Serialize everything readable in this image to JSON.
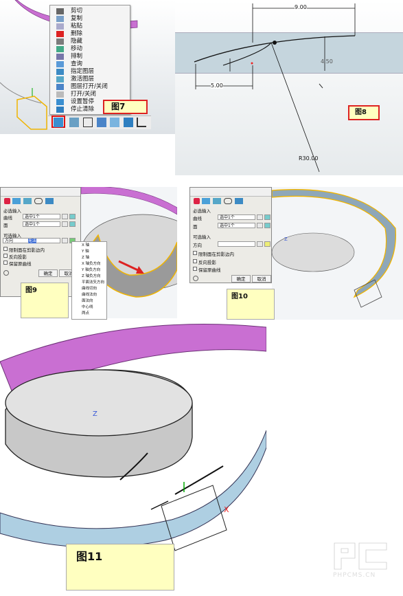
{
  "fig7": {
    "caption": "图7",
    "menu_items": [
      {
        "label": "剪切",
        "icon": "scissors-icon"
      },
      {
        "label": "复制",
        "icon": "copy-icon"
      },
      {
        "label": "粘贴",
        "icon": "paste-icon"
      },
      {
        "label": "删除",
        "icon": "delete-icon"
      },
      {
        "label": "隐藏",
        "icon": "hide-icon"
      },
      {
        "label": "移动",
        "icon": "move-icon"
      },
      {
        "label": "排制",
        "icon": "array-icon"
      },
      {
        "label": "查询",
        "icon": "query-icon"
      },
      {
        "label": "指定图层",
        "icon": "layer-icon"
      },
      {
        "label": "激活图层",
        "icon": "activate-layer-icon"
      },
      {
        "label": "图层打开/关闭",
        "icon": "layer-toggle-icon"
      },
      {
        "label": "打开/关闭",
        "icon": "toggle-icon"
      },
      {
        "label": "设置暂停",
        "icon": "pause-icon"
      },
      {
        "label": "停止清除",
        "icon": "stop-icon"
      }
    ]
  },
  "fig8": {
    "caption": "图8",
    "dim_top": "9.00",
    "dim_right": "4.50",
    "dim_left": "5.00",
    "dim_radius": "R30.00"
  },
  "fig9": {
    "caption": "图9",
    "section_required": "必选输入",
    "label_curve": "曲线",
    "value_curve": "选中1个",
    "label_face": "面",
    "value_face": "选中1个",
    "section_optional": "可选输入",
    "label_direction": "方向",
    "direction_value": "无法",
    "opt_limit": "限制面在剪影边内",
    "opt_reverse": "反向投影",
    "opt_keep": "保留原曲线",
    "ok": "确定",
    "cancel": "取消",
    "dropdown": [
      "X 轴",
      "Y 轴",
      "Z 轴",
      "X 轴负方向",
      "Y 轴负方向",
      "Z 轴负方向",
      "平面法矢方向",
      "曲线切向",
      "曲线法向",
      "面法向",
      "中心线",
      "两点"
    ]
  },
  "fig10": {
    "caption": "图10",
    "section_required": "必选输入",
    "label_curve": "曲线",
    "value_curve": "选中1个",
    "label_face": "面",
    "value_face": "选中1个",
    "section_optional": "可选输入",
    "label_direction": "方向",
    "opt_limit": "限制面在剪影边内",
    "opt_reverse": "反向投影",
    "opt_keep": "保留原曲线",
    "ok": "确定",
    "cancel": "取消",
    "axis_z": "Z"
  },
  "fig11": {
    "caption": "图11",
    "axis_z": "Z",
    "axis_x": "X"
  },
  "watermark": "PHPCMS.CN",
  "colors": {
    "ring_purple": "#c96fd2",
    "ring_teal": "#aecfe2",
    "highlight": "#f0b400",
    "caption_border": "#dd2222"
  }
}
